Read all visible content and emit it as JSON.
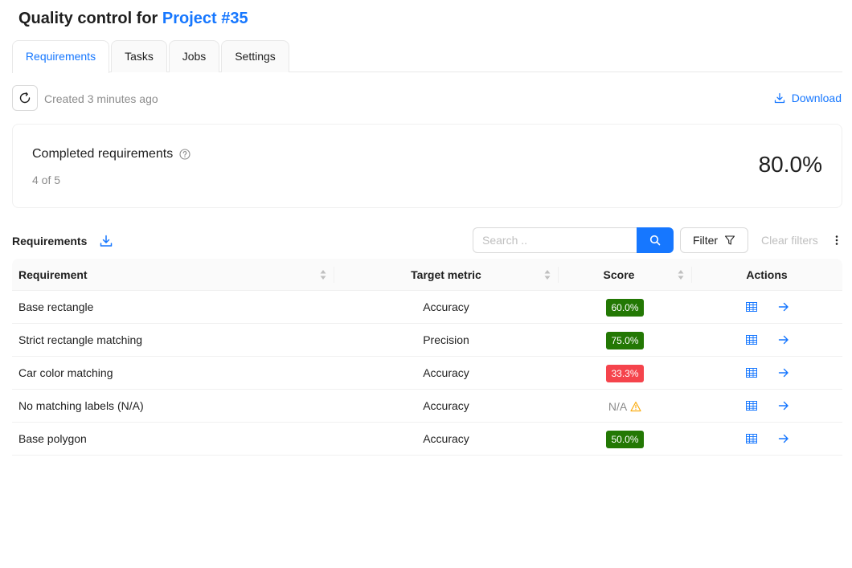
{
  "header": {
    "title_prefix": "Quality control for ",
    "project_link": "Project #35"
  },
  "tabs": [
    {
      "label": "Requirements",
      "active": true
    },
    {
      "label": "Tasks",
      "active": false
    },
    {
      "label": "Jobs",
      "active": false
    },
    {
      "label": "Settings",
      "active": false
    }
  ],
  "toolbar": {
    "created_text": "Created 3 minutes ago",
    "download_label": "Download"
  },
  "summary": {
    "label": "Completed requirements",
    "sub": "4 of 5",
    "value": "80.0%"
  },
  "requirements": {
    "heading": "Requirements",
    "search_placeholder": "Search ..",
    "filter_label": "Filter",
    "clear_filters_label": "Clear filters",
    "columns": {
      "requirement": "Requirement",
      "target_metric": "Target metric",
      "score": "Score",
      "actions": "Actions"
    },
    "rows": [
      {
        "requirement": "Base rectangle",
        "target_metric": "Accuracy",
        "score": "60.0%",
        "status": "pass"
      },
      {
        "requirement": "Strict rectangle matching",
        "target_metric": "Precision",
        "score": "75.0%",
        "status": "pass"
      },
      {
        "requirement": "Car color matching",
        "target_metric": "Accuracy",
        "score": "33.3%",
        "status": "fail"
      },
      {
        "requirement": "No matching labels (N/A)",
        "target_metric": "Accuracy",
        "score": "N/A",
        "status": "na"
      },
      {
        "requirement": "Base polygon",
        "target_metric": "Accuracy",
        "score": "50.0%",
        "status": "pass"
      }
    ]
  },
  "colors": {
    "accent": "#1677ff",
    "pass": "#237804",
    "fail": "#f5444c",
    "warning": "#faad14"
  }
}
